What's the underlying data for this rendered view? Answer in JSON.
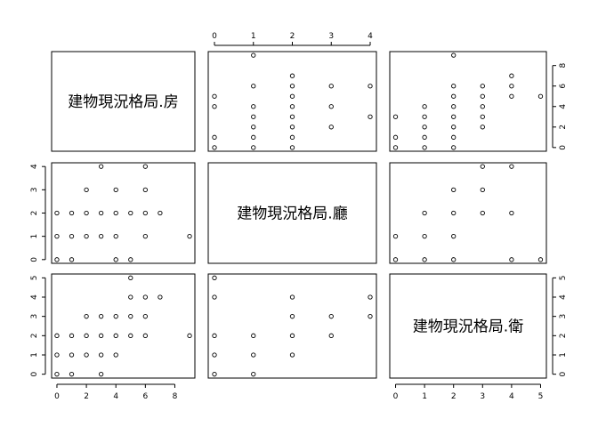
{
  "chart_data": {
    "type": "scatter",
    "variables": [
      {
        "name": "建物現況格局.房",
        "range": [
          0,
          9
        ],
        "ticks": [
          0,
          2,
          4,
          6,
          8
        ],
        "tick_labels": [
          "0",
          "2",
          "4",
          "6",
          "8"
        ]
      },
      {
        "name": "建物現況格局.廳",
        "range": [
          0,
          4
        ],
        "ticks": [
          0,
          1,
          2,
          3,
          4
        ],
        "tick_labels": [
          "0",
          "1",
          "2",
          "3",
          "4"
        ]
      },
      {
        "name": "建物現況格局.衛",
        "range": [
          0,
          5
        ],
        "ticks": [
          0,
          1,
          2,
          3,
          4,
          5
        ],
        "tick_labels": [
          "0",
          "1",
          "2",
          "3",
          "4",
          "5"
        ]
      }
    ],
    "pairs": [
      {
        "x": "建物現況格局.房",
        "y": "建物現況格局.廳",
        "points": [
          [
            0,
            0
          ],
          [
            0,
            1
          ],
          [
            0,
            2
          ],
          [
            1,
            0
          ],
          [
            1,
            1
          ],
          [
            1,
            2
          ],
          [
            2,
            1
          ],
          [
            2,
            2
          ],
          [
            2,
            3
          ],
          [
            3,
            1
          ],
          [
            3,
            2
          ],
          [
            3,
            4
          ],
          [
            4,
            0
          ],
          [
            4,
            1
          ],
          [
            4,
            2
          ],
          [
            4,
            3
          ],
          [
            5,
            0
          ],
          [
            5,
            2
          ],
          [
            6,
            1
          ],
          [
            6,
            2
          ],
          [
            6,
            3
          ],
          [
            6,
            4
          ],
          [
            7,
            2
          ],
          [
            9,
            1
          ]
        ]
      },
      {
        "x": "建物現況格局.房",
        "y": "建物現況格局.衛",
        "points": [
          [
            0,
            0
          ],
          [
            0,
            1
          ],
          [
            0,
            2
          ],
          [
            1,
            0
          ],
          [
            1,
            1
          ],
          [
            1,
            2
          ],
          [
            2,
            1
          ],
          [
            2,
            2
          ],
          [
            2,
            3
          ],
          [
            3,
            0
          ],
          [
            3,
            1
          ],
          [
            3,
            2
          ],
          [
            3,
            3
          ],
          [
            4,
            1
          ],
          [
            4,
            2
          ],
          [
            4,
            3
          ],
          [
            5,
            2
          ],
          [
            5,
            3
          ],
          [
            5,
            4
          ],
          [
            5,
            5
          ],
          [
            6,
            2
          ],
          [
            6,
            3
          ],
          [
            6,
            4
          ],
          [
            7,
            4
          ],
          [
            9,
            2
          ]
        ]
      },
      {
        "x": "建物現況格局.廳",
        "y": "建物現況格局.衛",
        "points": [
          [
            0,
            0
          ],
          [
            0,
            1
          ],
          [
            0,
            2
          ],
          [
            0,
            4
          ],
          [
            0,
            5
          ],
          [
            1,
            0
          ],
          [
            1,
            1
          ],
          [
            1,
            2
          ],
          [
            2,
            1
          ],
          [
            2,
            2
          ],
          [
            2,
            3
          ],
          [
            2,
            4
          ],
          [
            3,
            2
          ],
          [
            3,
            3
          ],
          [
            4,
            3
          ],
          [
            4,
            4
          ]
        ]
      }
    ]
  }
}
